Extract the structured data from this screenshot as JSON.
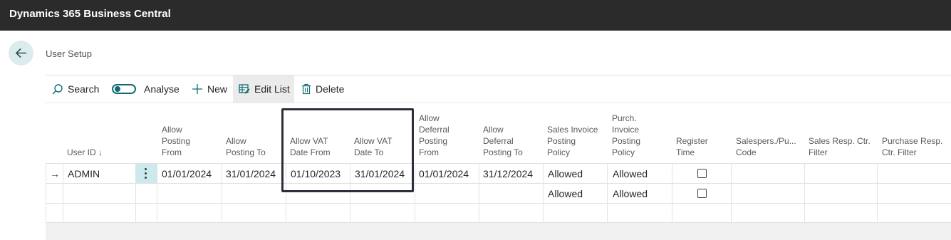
{
  "app": {
    "title": "Dynamics 365 Business Central"
  },
  "page": {
    "title": "User Setup"
  },
  "actions": {
    "search": "Search",
    "analyse": "Analyse",
    "new": "New",
    "edit_list": "Edit List",
    "delete": "Delete"
  },
  "columns": {
    "user_id": "User ID",
    "sort_indicator": "↓",
    "allow_posting_from": [
      "Allow",
      "Posting",
      "From"
    ],
    "allow_posting_to": [
      "Allow",
      "Posting To"
    ],
    "allow_vat_date_from": [
      "Allow VAT",
      "Date From"
    ],
    "allow_vat_date_to": [
      "Allow VAT",
      "Date To"
    ],
    "allow_deferral_posting_from": [
      "Allow",
      "Deferral",
      "Posting",
      "From"
    ],
    "allow_deferral_posting_to": [
      "Allow",
      "Deferral",
      "Posting To"
    ],
    "sales_invoice_posting_policy": [
      "Sales Invoice",
      "Posting",
      "Policy"
    ],
    "purch_invoice_posting_policy": [
      "Purch.",
      "Invoice",
      "Posting",
      "Policy"
    ],
    "register_time": [
      "Register",
      "Time"
    ],
    "salespers_code": [
      "Salespers./Pu...",
      "Code"
    ],
    "sales_resp_ctr_filter": [
      "Sales Resp. Ctr.",
      "Filter"
    ],
    "purchase_resp_ctr_filter": [
      "Purchase Resp.",
      "Ctr. Filter"
    ]
  },
  "rows": [
    {
      "row_marker": "→",
      "user_id": "ADMIN",
      "allow_posting_from": "01/01/2024",
      "allow_posting_to": "31/01/2024",
      "allow_vat_date_from": "01/10/2023",
      "allow_vat_date_to": "31/01/2024",
      "allow_deferral_posting_from": "01/01/2024",
      "allow_deferral_posting_to": "31/12/2024",
      "sales_invoice_posting_policy": "Allowed",
      "purch_invoice_posting_policy": "Allowed",
      "register_time": false
    },
    {
      "sales_invoice_posting_policy": "Allowed",
      "purch_invoice_posting_policy": "Allowed",
      "register_time": false
    }
  ],
  "colors": {
    "topbar": "#2b2b2b",
    "accent": "#0f6b73",
    "selection": "#cde9ec",
    "highlight_border": "#2b3038"
  }
}
